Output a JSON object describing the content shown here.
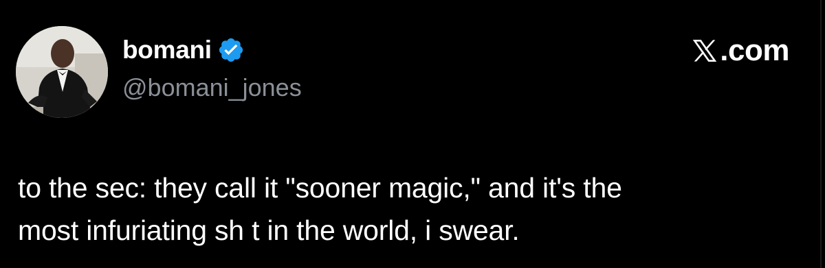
{
  "tweet": {
    "display_name": "bomani",
    "handle": "@bomani_jones",
    "verified": true,
    "text_line_1": "to the sec: they call it \"sooner magic,\" and it's the",
    "text_line_2": "most infuriating sh t in the world, i swear."
  },
  "brand": {
    "icon": "x-logo-icon",
    "suffix": ".com"
  },
  "colors": {
    "background": "#000000",
    "text": "#ffffff",
    "handle": "#8b9098",
    "verified": "#1d9bf0"
  },
  "icons": {
    "avatar": "avatar",
    "verified": "verified-badge-icon"
  }
}
